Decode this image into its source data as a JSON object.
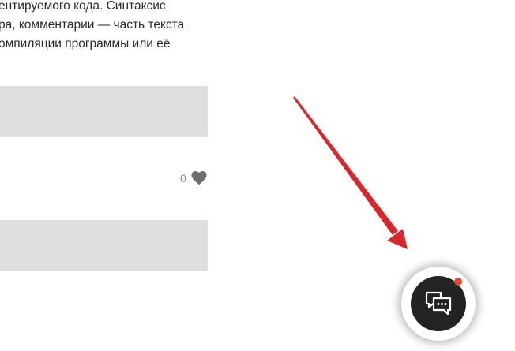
{
  "article": {
    "lines": [
      "ентируемого кода. Синтаксис",
      "ра, комментарии — часть текста",
      "омпиляции программы или её"
    ]
  },
  "likes": {
    "count": "0",
    "icon": "heart-icon"
  },
  "chat_widget": {
    "icon": "chat-bubbles-icon",
    "has_notification": true,
    "colors": {
      "button": "#232323",
      "notification": "#e8452f",
      "arrow": "#d9262b"
    }
  }
}
